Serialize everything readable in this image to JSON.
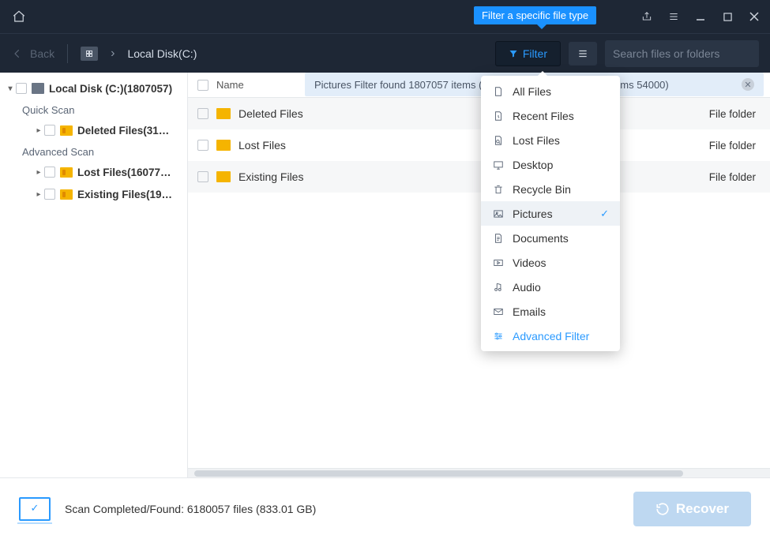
{
  "tooltip": "Filter a specific file type",
  "toolbar": {
    "back_label": "Back",
    "breadcrumb": "Local Disk(C:)",
    "filter_label": "Filter",
    "search_placeholder": "Search files or folders"
  },
  "sidebar": {
    "root_label": "Local Disk (C:)(1807057)",
    "section_quick": "Quick Scan",
    "section_advanced": "Advanced Scan",
    "items": [
      {
        "label": "Deleted Files(31…"
      },
      {
        "label": "Lost Files(16077…"
      },
      {
        "label": "Existing Files(19…"
      }
    ]
  },
  "columns": {
    "name": "Name"
  },
  "filter_notice": "Pictures Filter found 1807057 items (Total size 4.91 GB, Deleted items 54000)",
  "files": [
    {
      "name": "Deleted Files",
      "type": "File folder"
    },
    {
      "name": "Lost Files",
      "type": "File folder"
    },
    {
      "name": "Existing Files",
      "type": "File folder"
    }
  ],
  "dropdown": {
    "items": [
      {
        "label": "All Files",
        "icon": "file-icon"
      },
      {
        "label": "Recent Files",
        "icon": "recent-icon"
      },
      {
        "label": "Lost Files",
        "icon": "lost-icon"
      },
      {
        "label": "Desktop",
        "icon": "desktop-icon"
      },
      {
        "label": "Recycle Bin",
        "icon": "recycle-icon"
      },
      {
        "label": "Pictures",
        "icon": "pictures-icon",
        "selected": true
      },
      {
        "label": "Documents",
        "icon": "documents-icon"
      },
      {
        "label": "Videos",
        "icon": "videos-icon"
      },
      {
        "label": "Audio",
        "icon": "audio-icon"
      },
      {
        "label": "Emails",
        "icon": "emails-icon"
      }
    ],
    "advanced_label": "Advanced Filter"
  },
  "footer": {
    "status": "Scan Completed/Found: 6180057 files (833.01 GB)",
    "recover_label": "Recover"
  }
}
